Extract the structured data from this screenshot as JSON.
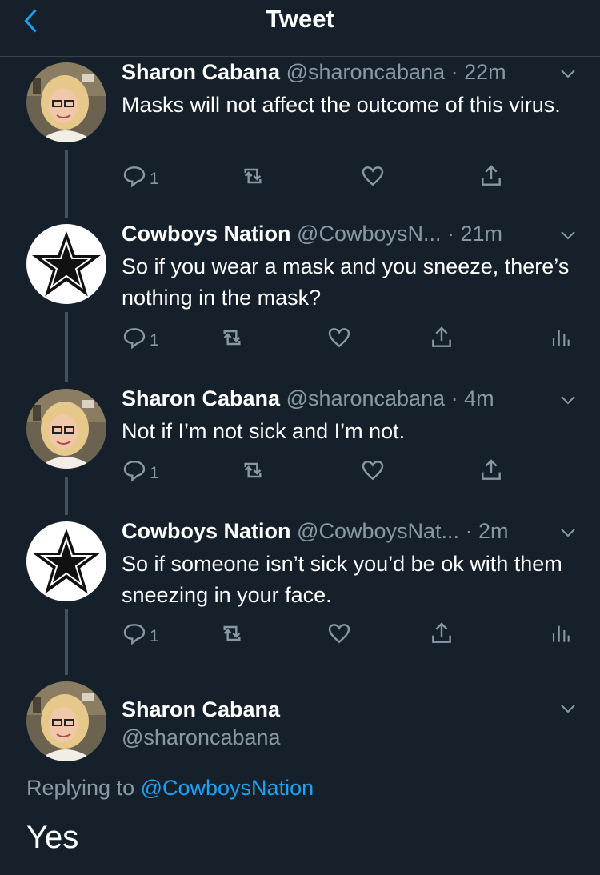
{
  "header": {
    "title": "Tweet"
  },
  "tweets": [
    {
      "name": "Sharon Cabana",
      "handle": "@sharoncabana",
      "time": "· 22m",
      "text": "Masks will not affect the outcome of this virus.",
      "replies": "1",
      "avatar": "sharon"
    },
    {
      "name": "Cowboys Nation",
      "handle": "@CowboysN...",
      "time": " · 21m",
      "text": "So if you wear a mask and you sneeze, there’s nothing in the mask?",
      "replies": "1",
      "avatar": "star"
    },
    {
      "name": "Sharon Cabana",
      "handle": "@sharoncabana",
      "time": "· 4m",
      "text": "Not if I’m not sick and I’m not.",
      "replies": "1",
      "avatar": "sharon"
    },
    {
      "name": "Cowboys Nation",
      "handle": "@CowboysNat...",
      "time": "· 2m",
      "text": "So if someone isn’t sick you’d be ok with them sneezing in your face.",
      "replies": "1",
      "avatar": "star"
    }
  ],
  "main_tweet": {
    "name": "Sharon Cabana",
    "handle": "@sharoncabana",
    "replying_prefix": "Replying to ",
    "replying_to": "@CowboysNation",
    "text": "Yes"
  },
  "colors": {
    "background": "#15202b",
    "secondary_text": "#8899a6",
    "accent": "#1da1f2",
    "divider": "#38444d"
  }
}
